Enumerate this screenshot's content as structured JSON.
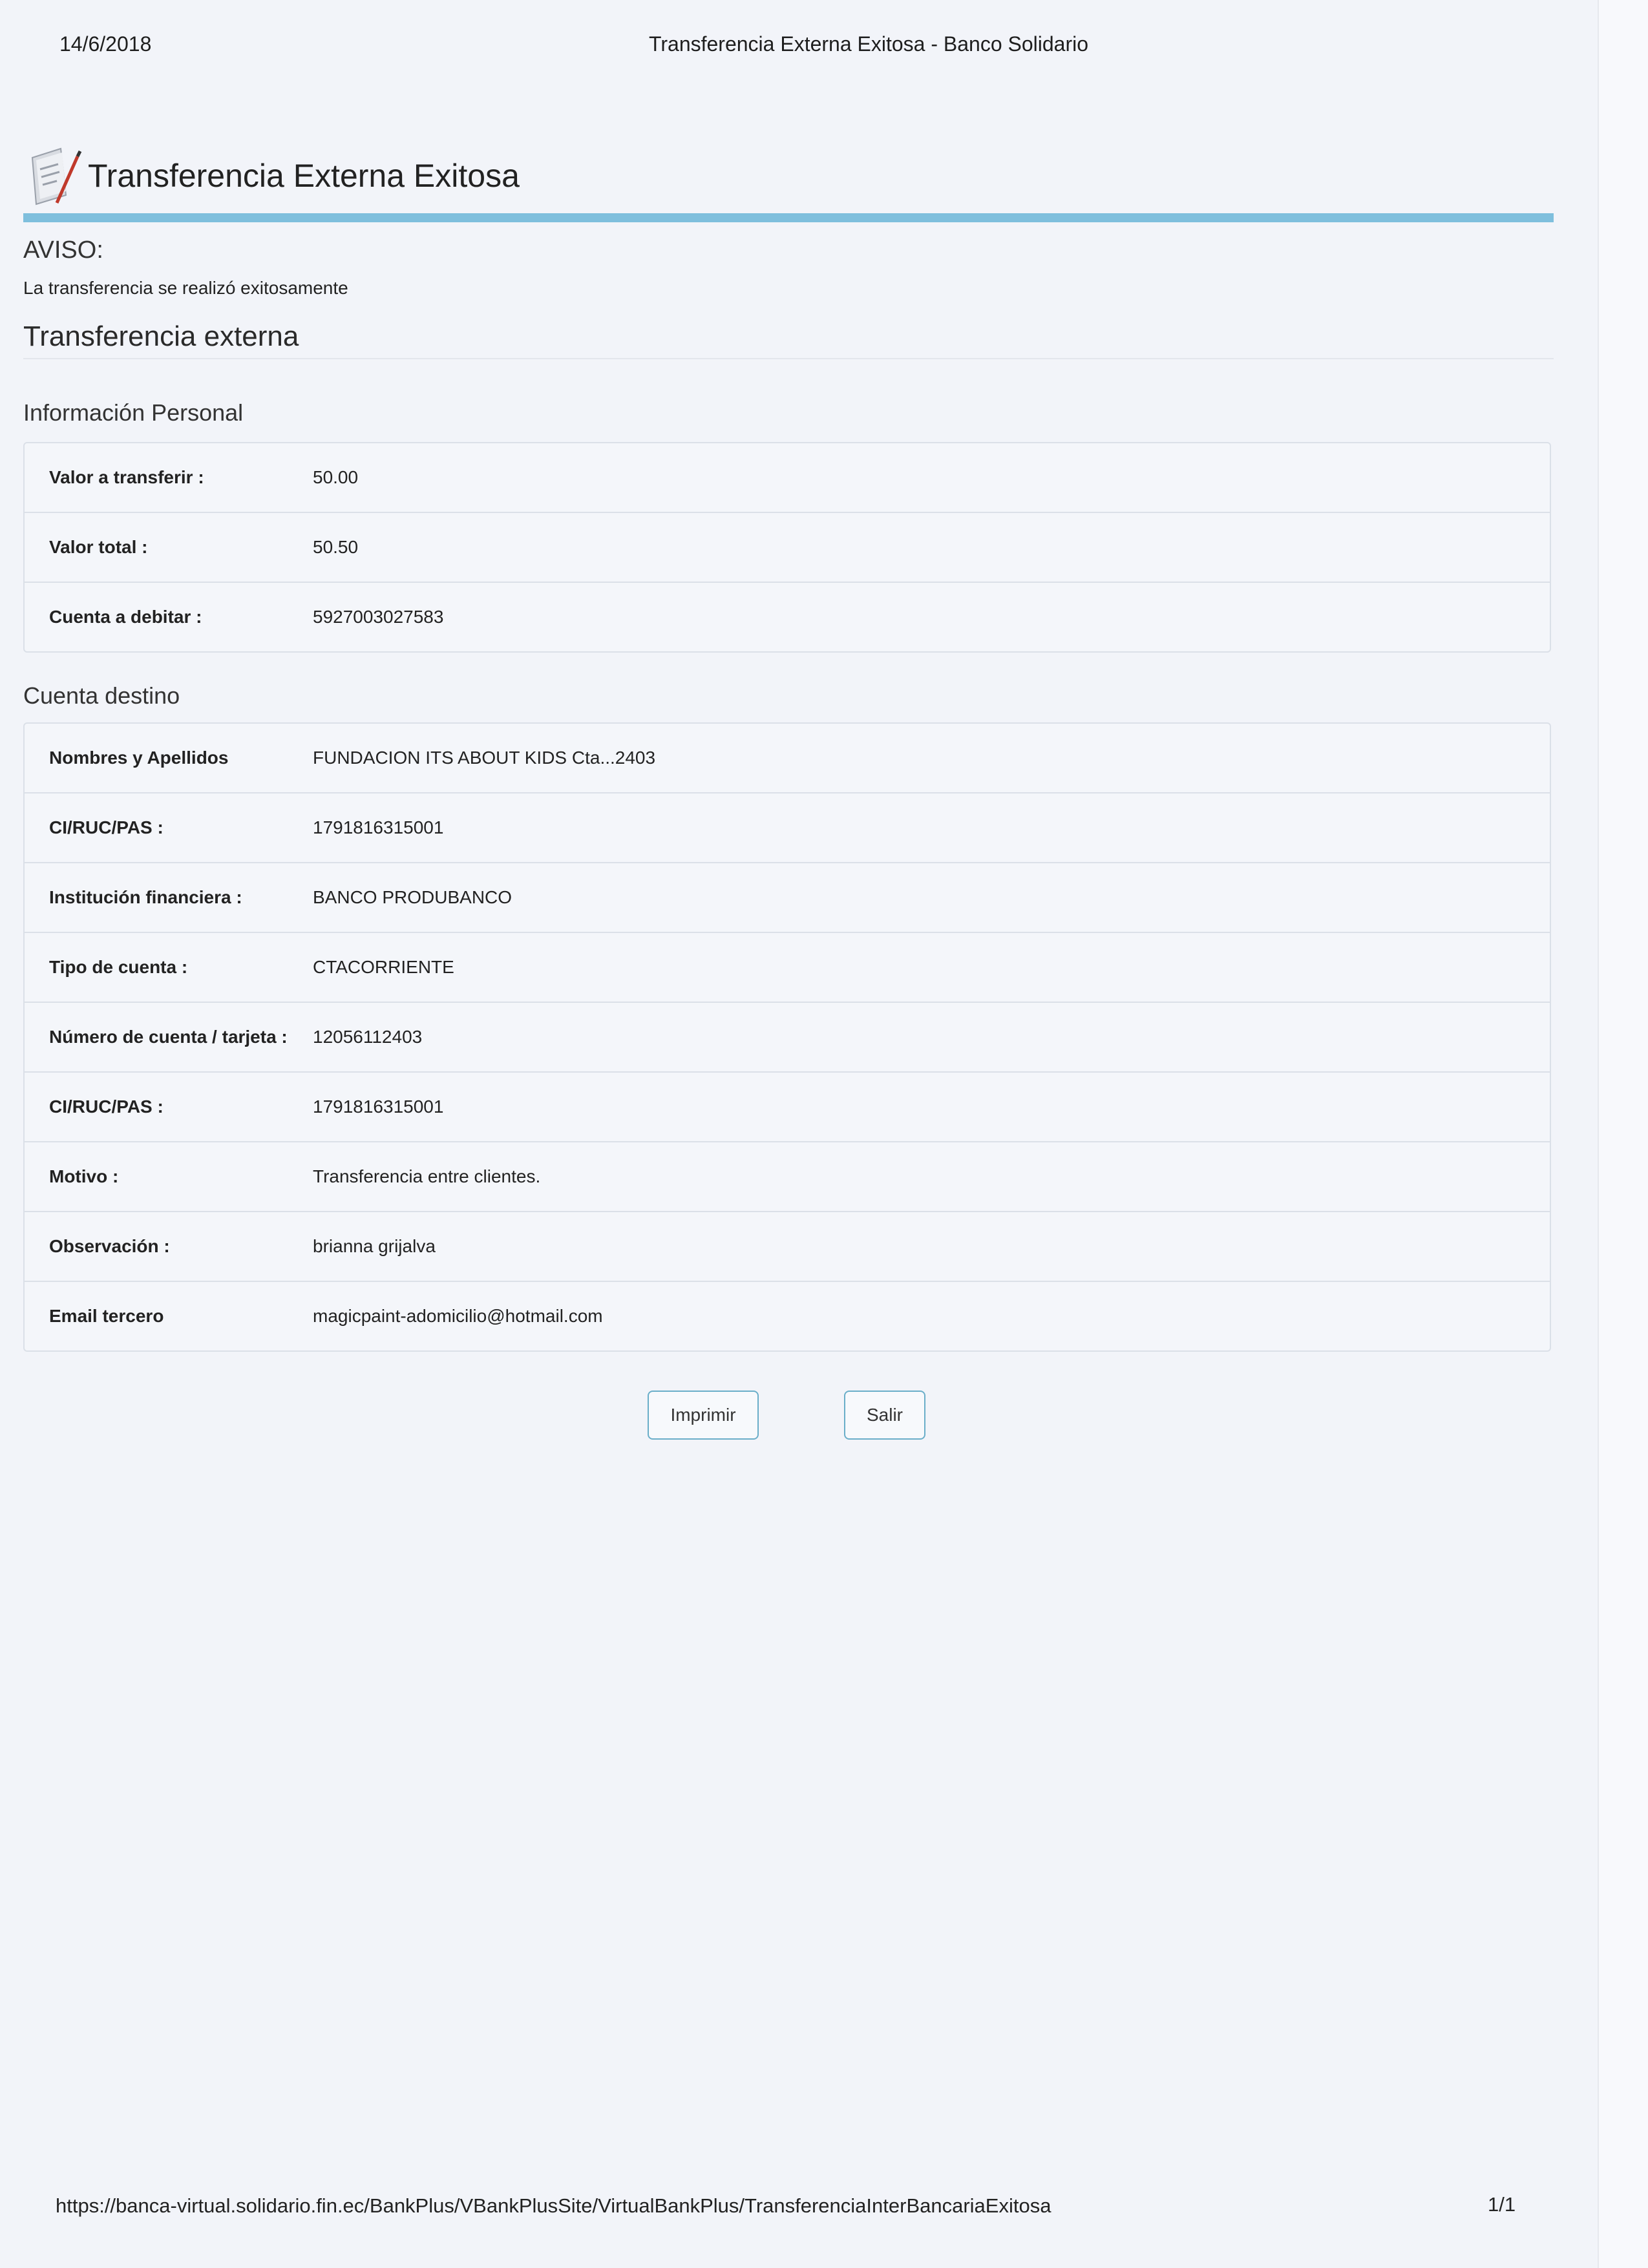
{
  "print_header": {
    "date": "14/6/2018",
    "doc_title": "Transferencia Externa Exitosa - Banco Solidario"
  },
  "page": {
    "title": "Transferencia Externa Exitosa",
    "title_icon": "document-pen-icon",
    "accent_color": "#7fbfdd"
  },
  "notice": {
    "heading": "AVISO:",
    "message": "La transferencia se realizó exitosamente"
  },
  "section": {
    "title": "Transferencia externa"
  },
  "personal_info": {
    "title": "Información Personal",
    "rows": [
      {
        "label": "Valor a transferir :",
        "value": "50.00"
      },
      {
        "label": "Valor total :",
        "value": "50.50"
      },
      {
        "label": "Cuenta a debitar :",
        "value": "5927003027583"
      }
    ]
  },
  "destination": {
    "title": "Cuenta destino",
    "rows": [
      {
        "label": "Nombres y Apellidos",
        "value": "FUNDACION ITS ABOUT KIDS Cta...2403"
      },
      {
        "label": "CI/RUC/PAS :",
        "value": "1791816315001"
      },
      {
        "label": "Institución financiera :",
        "value": "BANCO PRODUBANCO"
      },
      {
        "label": "Tipo de cuenta :",
        "value": "CTACORRIENTE"
      },
      {
        "label": "Número de cuenta / tarjeta :",
        "value": "12056112403"
      },
      {
        "label": "CI/RUC/PAS :",
        "value": "1791816315001"
      },
      {
        "label": "Motivo :",
        "value": "Transferencia entre clientes."
      },
      {
        "label": "Observación :",
        "value": "brianna grijalva"
      },
      {
        "label": "Email tercero",
        "value": "magicpaint-adomicilio@hotmail.com"
      }
    ]
  },
  "actions": {
    "print_label": "Imprimir",
    "exit_label": "Salir"
  },
  "print_footer": {
    "url": "https://banca-virtual.solidario.fin.ec/BankPlus/VBankPlusSite/VirtualBankPlus/TransferenciaInterBancariaExitosa",
    "page_number": "1/1"
  }
}
